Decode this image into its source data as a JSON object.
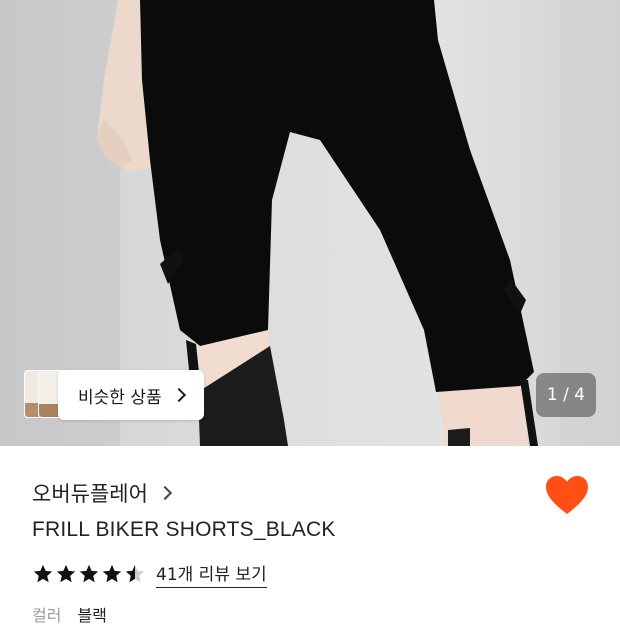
{
  "hero": {
    "similar_label": "비슷한 상품",
    "page_counter": "1 / 4"
  },
  "product": {
    "brand": "오버듀플레어",
    "title": "FRILL BIKER SHORTS_BLACK",
    "rating": 4.5,
    "review_link": "41개 리뷰 보기",
    "color_label": "컬러",
    "color_value": "블랙",
    "favorited": true
  },
  "colors": {
    "heart": "#ff4f14",
    "text": "#222222",
    "muted": "#9b9b9b"
  },
  "icons": [
    "chevron-right-icon",
    "heart-icon",
    "star-icon"
  ]
}
